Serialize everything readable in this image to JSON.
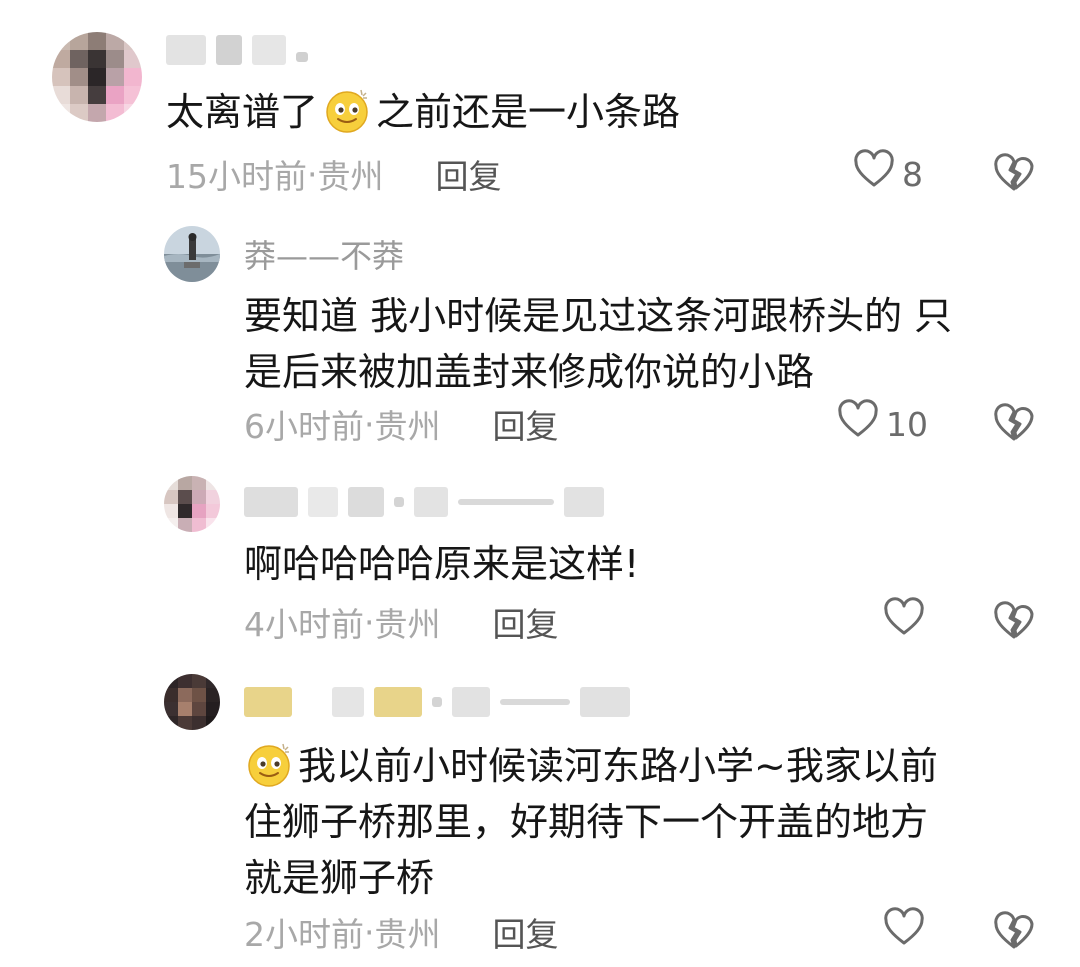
{
  "comments": [
    {
      "username": "",
      "text_before_emoji": "太离谱了",
      "text_after_emoji": "之前还是一小条路",
      "emoji": "smirk-emoji",
      "time": "15小时前",
      "location": "贵州",
      "reply_label": "回复",
      "likes": "8"
    },
    {
      "username": "莽——不莽",
      "text_lines": [
        "要知道 我小时候是见过这条河跟桥头的 只",
        "是后来被加盖封来修成你说的小路"
      ],
      "time": "6小时前",
      "location": "贵州",
      "reply_label": "回复",
      "likes": "10"
    },
    {
      "username": "",
      "text_lines": [
        "啊哈哈哈哈原来是这样!"
      ],
      "time": "4小时前",
      "location": "贵州",
      "reply_label": "回复",
      "likes": ""
    },
    {
      "username": "",
      "emoji": "smirk-emoji",
      "text_first_line": "我以前小时候读河东路小学~我家以前",
      "text_lines": [
        "住狮子桥那里，好期待下一个开盖的地方",
        "就是狮子桥"
      ],
      "time": "2小时前",
      "location": "贵州",
      "reply_label": "回复",
      "likes": ""
    }
  ],
  "separator": " · ",
  "colors": {
    "text": "#161616",
    "meta": "#a8a8a8",
    "reply": "#555555",
    "icon": "#6b6b6b"
  }
}
